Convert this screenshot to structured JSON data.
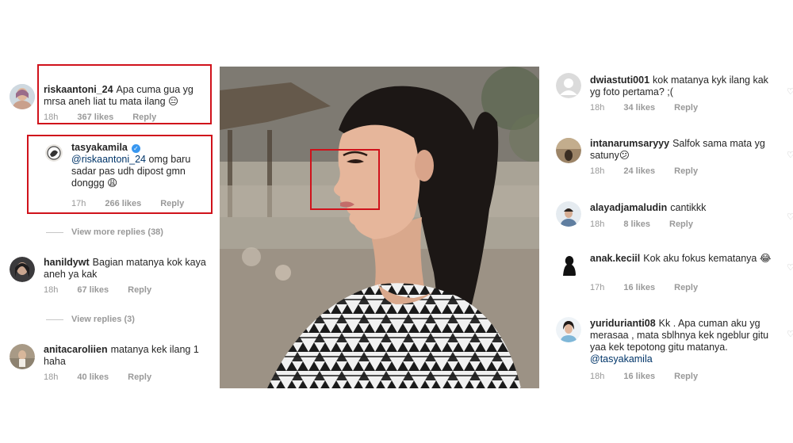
{
  "left_comments": [
    {
      "username": "riskaantoni_24",
      "text": "Apa cuma gua yg mrsa aneh liat tu mata ilang 😑",
      "time": "18h",
      "likes": "367 likes",
      "reply": "Reply"
    },
    {
      "username": "tasyakamila",
      "mention": "@riskaantoni_24",
      "text": "omg baru sadar pas udh dipost gmn donggg 😩",
      "time": "17h",
      "likes": "266 likes",
      "reply": "Reply"
    },
    {
      "view_more": "View more replies (38)"
    },
    {
      "username": "hanildywt",
      "text": "Bagian matanya kok kaya aneh ya kak",
      "time": "18h",
      "likes": "67 likes",
      "reply": "Reply"
    },
    {
      "view_more": "View replies (3)"
    },
    {
      "username": "anitacaroliien",
      "text": "matanya kek ilang 1 haha",
      "time": "18h",
      "likes": "40 likes",
      "reply": "Reply"
    }
  ],
  "right_comments": [
    {
      "username": "dwiastuti001",
      "text": "kok matanya kyk ilang kak yg foto pertama? ;(",
      "time": "18h",
      "likes": "34 likes",
      "reply": "Reply"
    },
    {
      "username": "intanarumsaryyy",
      "text": "Salfok sama mata yg satuny😕",
      "time": "18h",
      "likes": "24 likes",
      "reply": "Reply"
    },
    {
      "username": "alayadjamaludin",
      "text": "cantikkk",
      "time": "18h",
      "likes": "8 likes",
      "reply": "Reply"
    },
    {
      "username": "anak.keciil",
      "text": "Kok aku fokus kematanya 😂",
      "time": "17h",
      "likes": "16 likes",
      "reply": "Reply"
    },
    {
      "username": "yuridurianti08",
      "text": "Kk . Apa cuman aku yg merasaa , mata sblhnya kek ngeblur gitu yaa kek tepotong gitu matanya.",
      "mention": "@tasyakamila",
      "time": "18h",
      "likes": "16 likes",
      "reply": "Reply"
    }
  ],
  "highlight_color": "#d0121b",
  "verified_color": "#3897f0",
  "icons": {
    "like": "heart-outline-icon",
    "verified": "verified-badge-icon"
  }
}
